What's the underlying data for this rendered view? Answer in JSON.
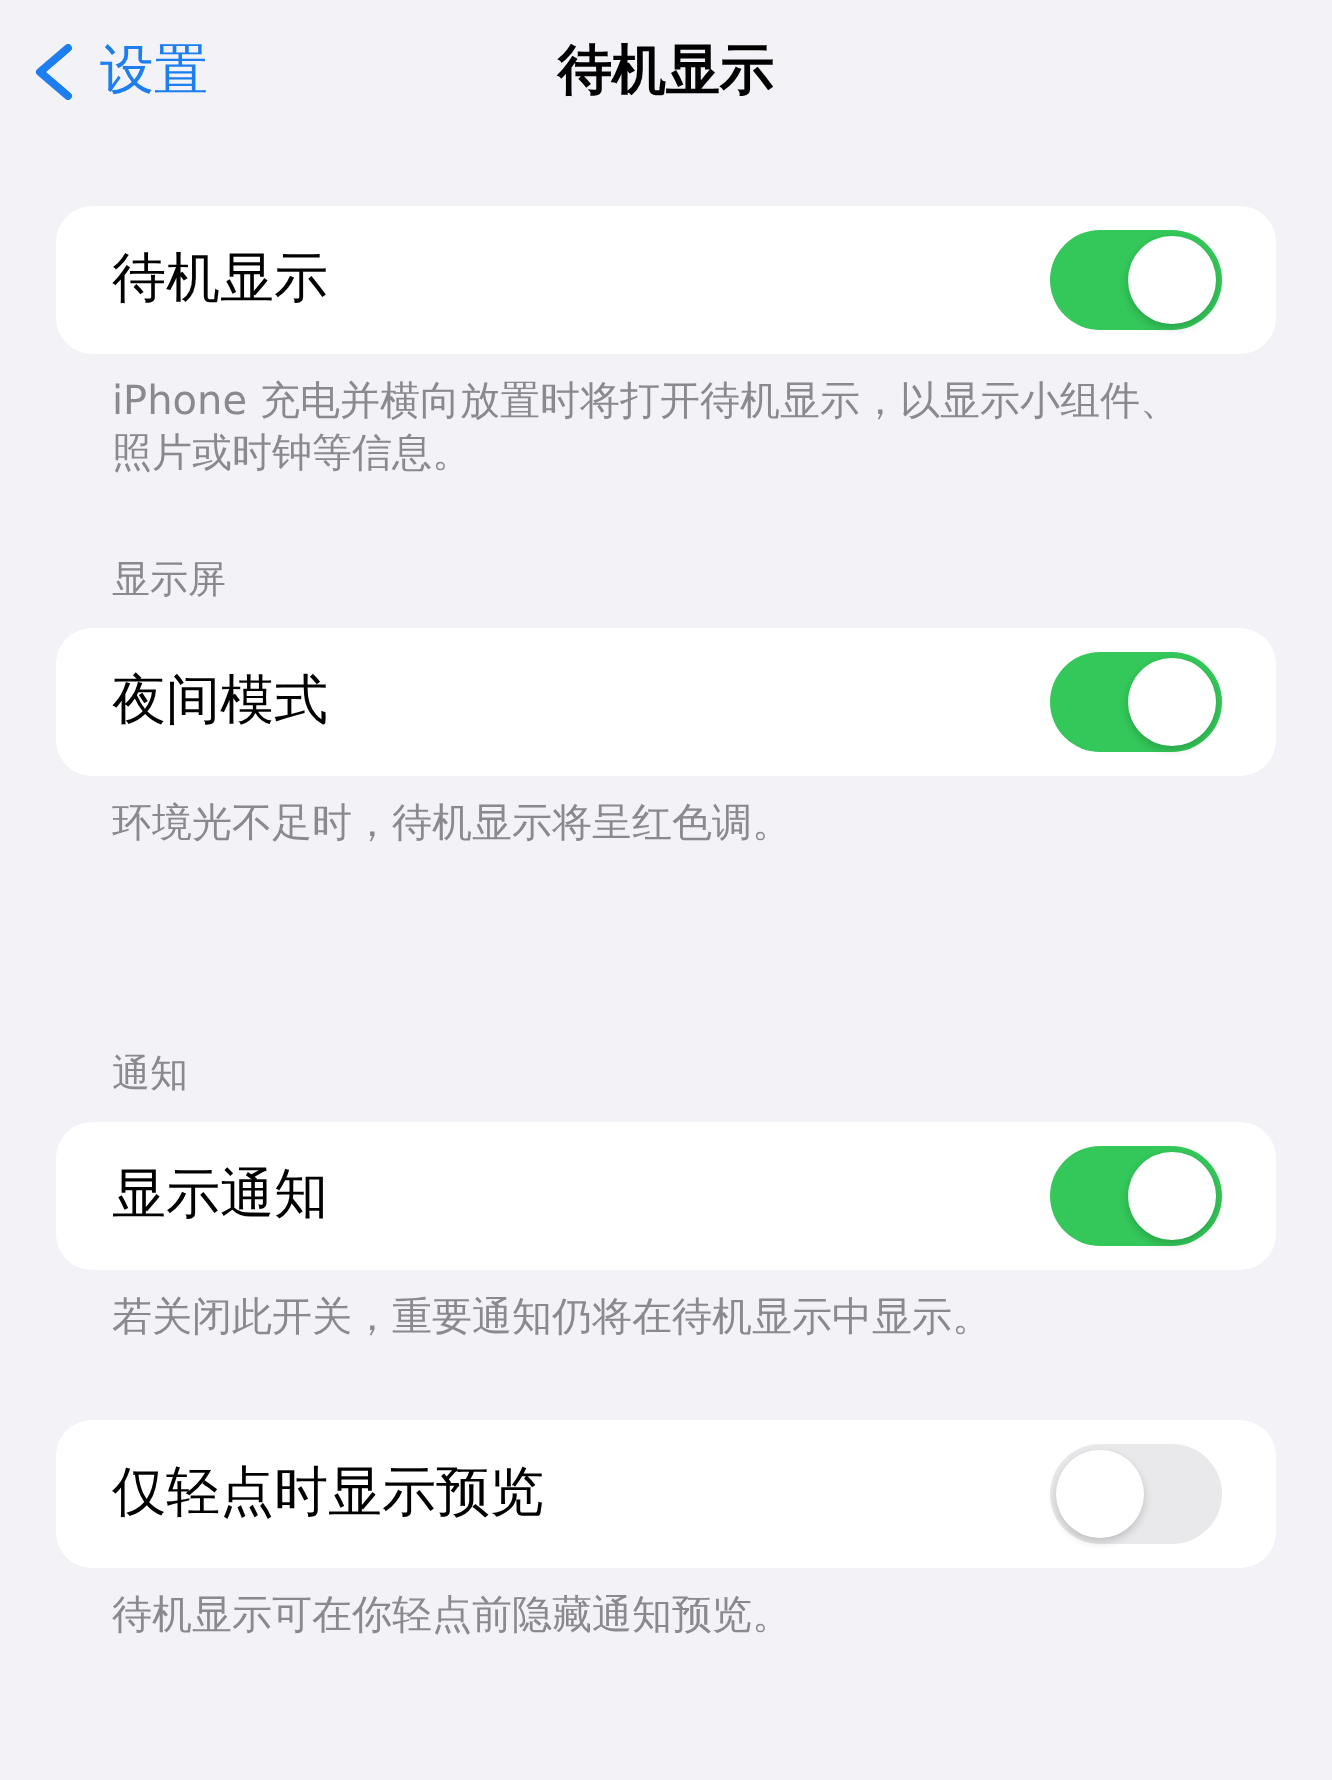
{
  "nav": {
    "back_label": "设置",
    "title": "待机显示"
  },
  "sections": [
    {
      "rows": [
        {
          "label": "待机显示",
          "on": true
        }
      ],
      "footer": "iPhone 充电并横向放置时将打开待机显示，以显示小组件、照片或时钟等信息。"
    },
    {
      "header": "显示屏",
      "rows": [
        {
          "label": "夜间模式",
          "on": true
        }
      ],
      "footer": "环境光不足时，待机显示将呈红色调。"
    },
    {
      "header": "通知",
      "rows": [
        {
          "label": "显示通知",
          "on": true
        }
      ],
      "footer": "若关闭此开关，重要通知仍将在待机显示中显示。"
    },
    {
      "rows": [
        {
          "label": "仅轻点时显示预览",
          "on": false
        }
      ],
      "footer": "待机显示可在你轻点前隐藏通知预览。"
    }
  ]
}
